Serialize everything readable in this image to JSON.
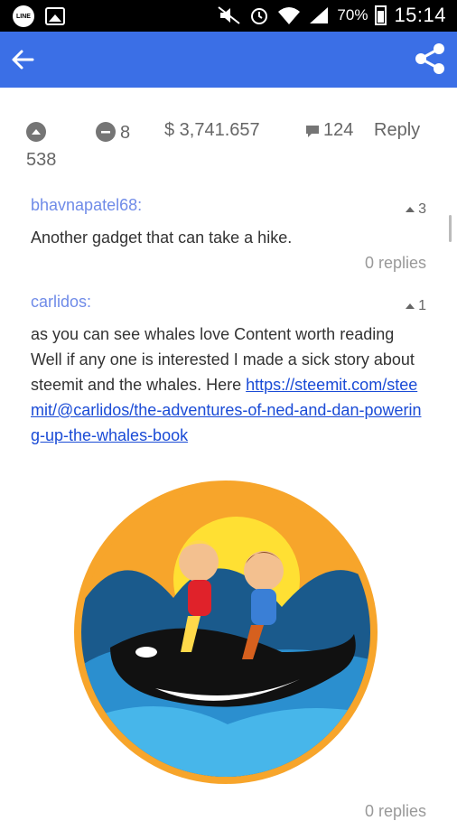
{
  "status_bar": {
    "line_label": "LINE",
    "battery": "70%",
    "time": "15:14"
  },
  "post_stats": {
    "upvotes": "538",
    "downvotes": "8",
    "payout": "$ 3,741.657",
    "comments": "124",
    "reply_label": "Reply"
  },
  "comments": [
    {
      "author": "bhavnapatel68:",
      "votes": "3",
      "text": "Another gadget that can take a hike.",
      "replies": "0 replies"
    },
    {
      "author": "carlidos:",
      "votes": "1",
      "text": "as you can see whales love Content worth reading Well if any one is interested I made a sick story about steemit and the whales. Here",
      "link": "https://steemit.com/steemit/@carlidos/the-adventures-of-ned-and-dan-powering-up-the-whales-book",
      "replies": "0 replies"
    }
  ],
  "colors": {
    "app_bar": "#3b6fe6",
    "author": "#6f8be8",
    "link": "#1a4bd6"
  }
}
